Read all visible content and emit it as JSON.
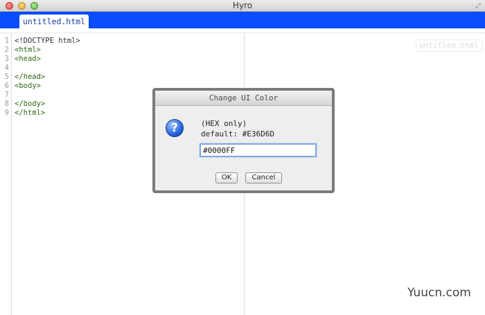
{
  "window": {
    "title": "Hyro"
  },
  "tabs": [
    {
      "label": "untitled.html"
    }
  ],
  "editor": {
    "line_numbers": [
      "1",
      "2",
      "3",
      "4",
      "5",
      "6",
      "7",
      "8",
      "9"
    ],
    "lines": [
      "<!DOCTYPE html>",
      "<html>",
      "<head>",
      "",
      "</head>",
      "<body>",
      "",
      "</body>",
      "</html>"
    ]
  },
  "preview": {
    "title": "untitled.html"
  },
  "dialog": {
    "title": "Change UI Color",
    "message_line1": "(HEX only)",
    "message_line2": "default: #E36D6D",
    "input_value": "#0000FF",
    "ok_label": "OK",
    "cancel_label": "Cancel"
  },
  "watermark": "Yuucn.com",
  "colors": {
    "tabbar": "#0a4cff",
    "code_text": "#2d6a12"
  }
}
